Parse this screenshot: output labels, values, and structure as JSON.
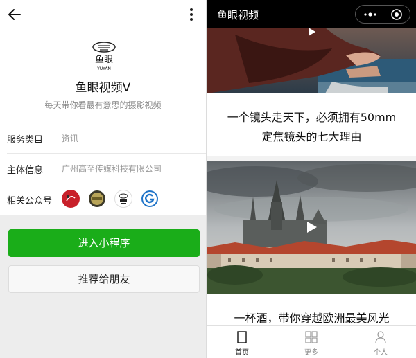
{
  "left": {
    "account": {
      "logo_text": "鱼眼",
      "logo_subtext": "YUYAN",
      "name": "鱼眼视频V",
      "description": "每天带你看最有意思的摄影视频"
    },
    "rows": {
      "category": {
        "label": "服务类目",
        "value": "资讯"
      },
      "entity": {
        "label": "主体信息",
        "value": "广州高至传媒科技有限公司"
      },
      "related": {
        "label": "相关公众号"
      }
    },
    "related_accounts": [
      {
        "name": "account-red",
        "color": "#c8202a"
      },
      {
        "name": "account-gold",
        "color": "#8a7a3a"
      },
      {
        "name": "account-yuyan",
        "color": "#ffffff"
      },
      {
        "name": "account-blue",
        "color": "#1e73c8"
      }
    ],
    "buttons": {
      "enter": "进入小程序",
      "recommend": "推荐给朋友"
    }
  },
  "right": {
    "topbar_title": "鱼眼视频",
    "cards": [
      {
        "title_line1": "一个镜头走天下，必须拥有50mm",
        "title_line2": "定焦镜头的七大理由"
      },
      {
        "title_line1": "一杯酒，带你穿越欧洲最美风光"
      }
    ],
    "tabs": [
      {
        "label": "首页",
        "active": true
      },
      {
        "label": "更多",
        "active": false
      },
      {
        "label": "个人",
        "active": false
      }
    ]
  },
  "colors": {
    "accent_green": "#1aad19",
    "tab_active": "#111111",
    "tab_inactive": "#888888"
  }
}
